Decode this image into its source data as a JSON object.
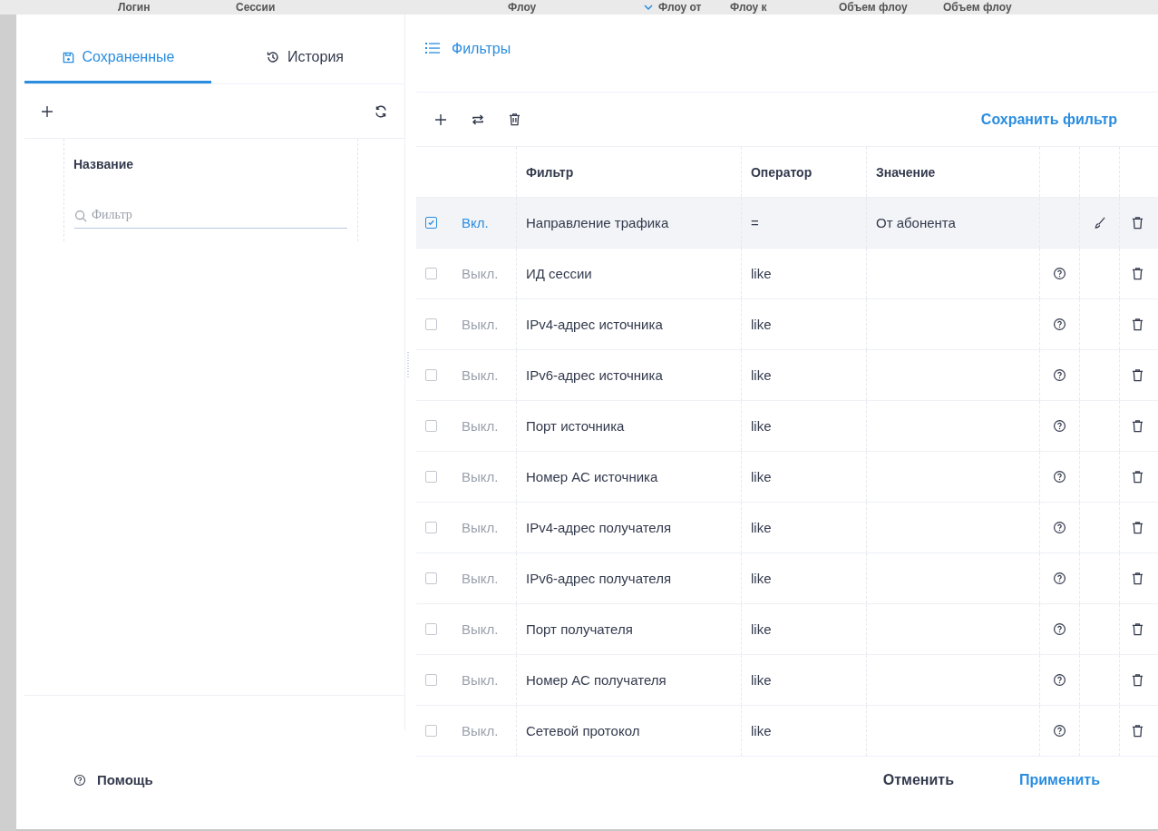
{
  "background_header": {
    "columns": [
      "Логин",
      "Сессии",
      "Флоу",
      "Флоу от",
      "Флоу к",
      "Объем флоу",
      "Объем флоу"
    ]
  },
  "tabs": [
    {
      "label": "Сохраненные",
      "kind": "saved",
      "selected": true
    },
    {
      "label": "История",
      "kind": "history",
      "selected": false
    }
  ],
  "saved": {
    "columns": [
      "Название"
    ],
    "search": {
      "placeholder": "Фильтр"
    }
  },
  "filters": {
    "title": "Фильтры",
    "save_link": "Сохранить фильтр",
    "columns": [
      "Фильтр",
      "Оператор",
      "Значение"
    ],
    "rows": [
      {
        "enabled": true,
        "selected": true,
        "status": "Вкл.",
        "name": "Направление трафика",
        "operator": "=",
        "value": "От абонента",
        "help": false,
        "edit": true
      },
      {
        "enabled": false,
        "selected": false,
        "status": "Выкл.",
        "name": "ИД сессии",
        "operator": "like",
        "help": true,
        "edit": false
      },
      {
        "enabled": false,
        "selected": false,
        "status": "Выкл.",
        "name": "IPv4-адрес источника",
        "operator": "like",
        "help": true,
        "edit": false
      },
      {
        "enabled": false,
        "selected": false,
        "status": "Выкл.",
        "name": "IPv6-адрес источника",
        "operator": "like",
        "help": true,
        "edit": false
      },
      {
        "enabled": false,
        "selected": false,
        "status": "Выкл.",
        "name": "Порт источника",
        "operator": "like",
        "help": true,
        "edit": false
      },
      {
        "enabled": false,
        "selected": false,
        "status": "Выкл.",
        "name": "Номер АС источника",
        "operator": "like",
        "help": true,
        "edit": false
      },
      {
        "enabled": false,
        "selected": false,
        "status": "Выкл.",
        "name": "IPv4-адрес получателя",
        "operator": "like",
        "help": true,
        "edit": false
      },
      {
        "enabled": false,
        "selected": false,
        "status": "Выкл.",
        "name": "IPv6-адрес получателя",
        "operator": "like",
        "help": true,
        "edit": false
      },
      {
        "enabled": false,
        "selected": false,
        "status": "Выкл.",
        "name": "Порт получателя",
        "operator": "like",
        "help": true,
        "edit": false
      },
      {
        "enabled": false,
        "selected": false,
        "status": "Выкл.",
        "name": "Номер АС получателя",
        "operator": "like",
        "help": true,
        "edit": false
      },
      {
        "enabled": false,
        "selected": false,
        "status": "Выкл.",
        "name": "Сетевой протокол",
        "operator": "like",
        "help": true,
        "edit": false
      }
    ]
  },
  "footer": {
    "help": "Помощь",
    "buttons": [
      {
        "label": "Отменить",
        "kind": "secondary"
      },
      {
        "label": "Применить",
        "kind": "primary"
      }
    ]
  }
}
